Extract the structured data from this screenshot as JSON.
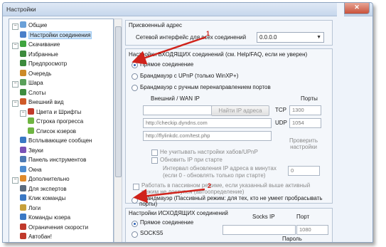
{
  "window": {
    "title": "Настройки",
    "close_label": "✕"
  },
  "tree": {
    "items": [
      {
        "label": "Общие",
        "icon": "gear-icon",
        "color": "#6aa0d8",
        "indent": 0,
        "exp": "-"
      },
      {
        "label": "Настройки соединения",
        "icon": "network-icon",
        "color": "#4a7fc9",
        "indent": 1,
        "selected": true
      },
      {
        "label": "Скачивание",
        "icon": "download-icon",
        "color": "#3fa43f",
        "indent": 0,
        "exp": "-"
      },
      {
        "label": "Избранные",
        "icon": "favorites-icon",
        "color": "#3c8a3c",
        "indent": 1
      },
      {
        "label": "Предпросмотр",
        "icon": "preview-icon",
        "color": "#3c8a3c",
        "indent": 1
      },
      {
        "label": "Очередь",
        "icon": "queue-icon",
        "color": "#cc8a28",
        "indent": 1
      },
      {
        "label": "Шара",
        "icon": "share-icon",
        "color": "#5aa05a",
        "indent": 0,
        "exp": "-"
      },
      {
        "label": "Слоты",
        "icon": "slots-icon",
        "color": "#3e8c3e",
        "indent": 1
      },
      {
        "label": "Внешний вид",
        "icon": "appearance-icon",
        "color": "#d05a28",
        "indent": 0,
        "exp": "-"
      },
      {
        "label": "Цвета и Шрифты",
        "icon": "colors-icon",
        "color": "#c0392b",
        "indent": 1,
        "exp": "-"
      },
      {
        "label": "Строка прогресса",
        "icon": "progress-icon",
        "color": "#6fb542",
        "indent": 2
      },
      {
        "label": "Список юзеров",
        "icon": "users-icon",
        "color": "#6fb542",
        "indent": 2
      },
      {
        "label": "Всплывающие сообщен",
        "icon": "popup-icon",
        "color": "#3a78c4",
        "indent": 1
      },
      {
        "label": "Звуки",
        "icon": "sound-icon",
        "color": "#7a52b6",
        "indent": 1
      },
      {
        "label": "Панель инструментов",
        "icon": "toolbar-icon",
        "color": "#4d7ab3",
        "indent": 1
      },
      {
        "label": "Окна",
        "icon": "windows-icon",
        "color": "#4d8cd0",
        "indent": 1
      },
      {
        "label": "Дополнительно",
        "icon": "advanced-icon",
        "color": "#e08a2a",
        "indent": 0,
        "exp": "-"
      },
      {
        "label": "Для экспертов",
        "icon": "experts-icon",
        "color": "#5b6b7d",
        "indent": 1
      },
      {
        "label": "Клик команды",
        "icon": "click-icon",
        "color": "#3a78c4",
        "indent": 1
      },
      {
        "label": "Логи",
        "icon": "logs-icon",
        "color": "#c7a03a",
        "indent": 1
      },
      {
        "label": "Команды юзера",
        "icon": "user-commands-icon",
        "color": "#3a78c4",
        "indent": 1
      },
      {
        "label": "Ограничения скорости",
        "icon": "speed-limit-icon",
        "color": "#c0392b",
        "indent": 1
      },
      {
        "label": "Автобан!",
        "icon": "autoban-icon",
        "color": "#c0392b",
        "indent": 1
      }
    ]
  },
  "assigned": {
    "title": "Присвоенный адрес",
    "label": "Сетевой интерфейс для всех соединений",
    "value": "0.0.0.0"
  },
  "incoming": {
    "title": "Настройки ВХОДЯЩИХ соединений (см. Help/FAQ, если не уверен)",
    "options": [
      "Прямое соединение",
      "Брандмауэр с UPnP (только WinXP+)",
      "Брандмауэр с ручным перенаправлением портов"
    ],
    "wan_label": "Внешний / WAN IP",
    "get_ip_button": "Найти IP адреса",
    "url1": "http://checkip.dyndns.com",
    "url2": "http://flylinkdc.com/test.php",
    "ports_label": "Порты",
    "tcp_label": "TCP",
    "tcp_value": "1300",
    "udp_label": "UDP",
    "udp_value": "1054",
    "check_label": "Проверить настройки",
    "ignore_upnp": "Не учитывать настройки хабов/UPnP",
    "update_ip": "Обновить IP при старте",
    "interval_label1": "Интервал обновления IP адреса в минутах",
    "interval_label2": "(если 0 - обновлять только при старте)",
    "interval_value": "0",
    "passive_check1": "Работать в пассивном режиме, если указанный выше активный",
    "passive_check2": "режим не доступен (автоопределение)",
    "passive_radio1": "Брандмауэр (Пассивный режим: для тех, кто не умеет пробрасывать",
    "passive_radio2": "порты)"
  },
  "outgoing": {
    "title": "Настройки ИСХОДЯЩИХ соединений",
    "options": [
      "Прямое соединение",
      "SOCKS5"
    ],
    "socks_ip": "Socks IP",
    "port_label": "Порт",
    "port_value": "1080",
    "password_label": "Пароль"
  },
  "annotations": {
    "n1": "1",
    "n2": "2",
    "color": "#d0231b"
  }
}
